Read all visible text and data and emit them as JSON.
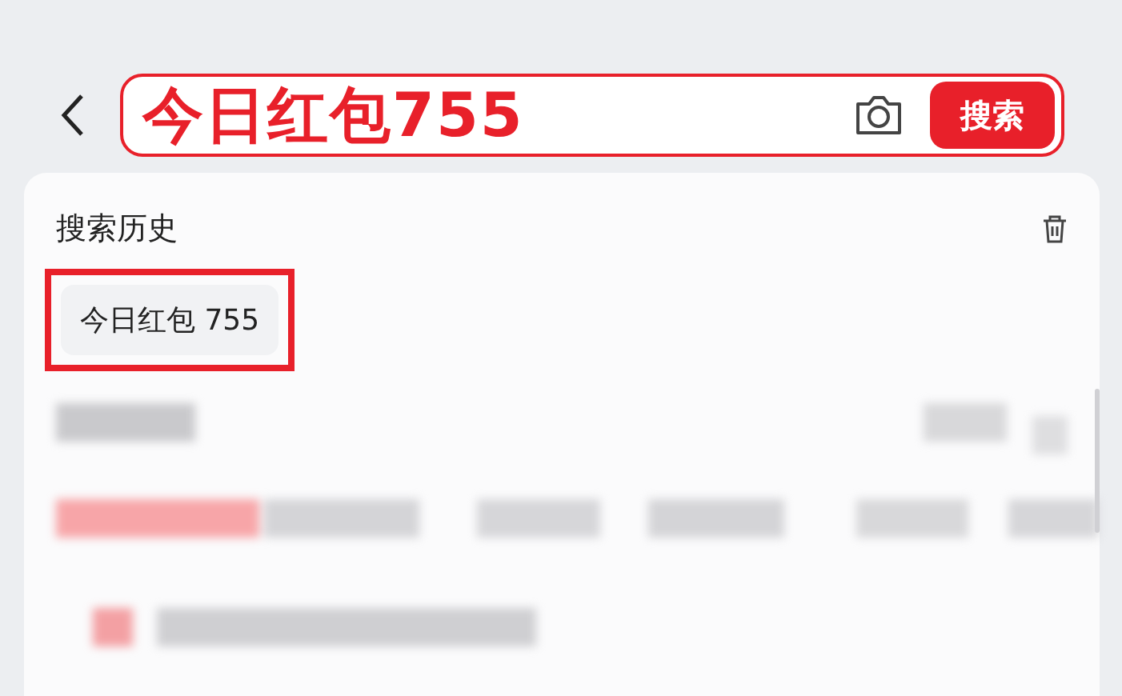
{
  "search_bar": {
    "value": "今日红包755",
    "button": "搜索"
  },
  "history": {
    "title": "搜索历史",
    "items": [
      {
        "label": "今日红包 755",
        "highlighted": true
      }
    ]
  }
}
